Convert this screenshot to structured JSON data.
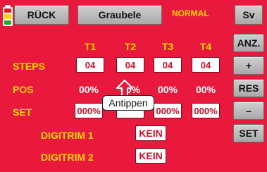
{
  "header": {
    "back_label": "RÜCK",
    "title": "Graubele",
    "mode": "NORMAL",
    "corner_label": "Sv"
  },
  "battery": {
    "segment_colors": [
      "#e02020",
      "#ffd400",
      "#1fa83a"
    ]
  },
  "columns": [
    "T1",
    "T2",
    "T3",
    "T4"
  ],
  "rows": {
    "steps": {
      "label": "STEPS",
      "values": [
        "04",
        "04",
        "04",
        "04"
      ]
    },
    "pos": {
      "label": "POS",
      "values": [
        "00%",
        "00%",
        "00%",
        "00%"
      ]
    },
    "set": {
      "label": "SET",
      "values": [
        "000%",
        "",
        "000%",
        "000%"
      ]
    }
  },
  "digitrim": [
    {
      "label": "DIGITRIM 1",
      "value": "KEIN"
    },
    {
      "label": "DIGITRIM 2",
      "value": "KEIN"
    }
  ],
  "side_buttons": {
    "anz": "ANZ.",
    "plus": "+",
    "res": "RES",
    "minus": "–",
    "set": "SET"
  },
  "callout": {
    "text": "Antippen"
  },
  "colors": {
    "background": "#e8193c",
    "label_yellow": "#ffd600",
    "value_red": "#c8102e"
  }
}
